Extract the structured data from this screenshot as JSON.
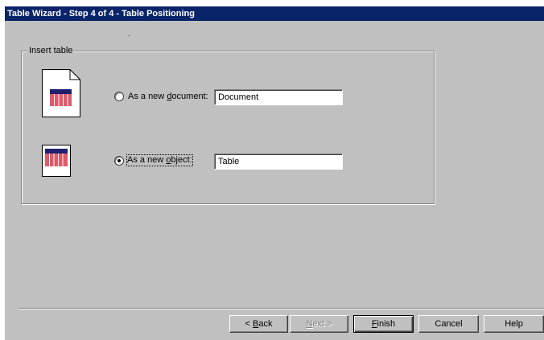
{
  "window": {
    "title": "Table Wizard - Step 4 of 4 - Table Positioning"
  },
  "insert_table": {
    "group_label": "Insert table",
    "options": [
      {
        "label_pre": "As a new ",
        "label_key": "d",
        "label_post": "ocument:",
        "value": "Document",
        "selected": false,
        "icon": "new-document-table-icon"
      },
      {
        "label_pre": "As a new ",
        "label_key": "o",
        "label_post": "bject:",
        "value": "Table",
        "selected": true,
        "icon": "embedded-table-object-icon"
      }
    ]
  },
  "buttons": {
    "back_pre": "< ",
    "back_key": "B",
    "back_post": "ack",
    "next_key": "N",
    "next_post": "ext >",
    "finish_key": "F",
    "finish_post": "inish",
    "cancel": "Cancel",
    "help": "Help"
  },
  "colors": {
    "titlebar": "#0a246a",
    "face": "#c0c0c0",
    "table_header": "#1f1f6e",
    "table_body": "#e05a6a"
  }
}
